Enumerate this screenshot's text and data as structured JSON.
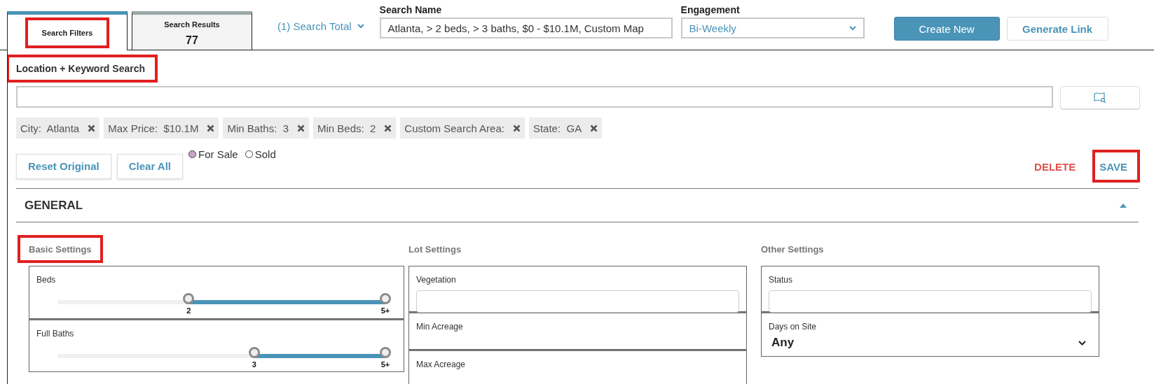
{
  "tabs": [
    {
      "label": "Search Filters",
      "selected": true,
      "highlighted": true
    },
    {
      "label": "Search Results",
      "count": "77",
      "selected": false,
      "highlighted": false
    }
  ],
  "search_total": {
    "label": "(1) Search Total"
  },
  "search_name": {
    "label": "Search Name",
    "value": "Atlanta, > 2 beds, > 3 baths, $0 - $10.1M, Custom Map"
  },
  "engagement": {
    "label": "Engagement",
    "value": "Bi-Weekly"
  },
  "header_buttons": [
    {
      "label": "Create New",
      "kind": "primary"
    },
    {
      "label": "Generate Link",
      "kind": "secondary"
    }
  ],
  "location_search": {
    "label": "Location + Keyword Search",
    "highlighted": true
  },
  "chips": [
    {
      "label": "City:  Atlanta"
    },
    {
      "label": "Max Price:  $10.1M"
    },
    {
      "label": "Min Baths:  3"
    },
    {
      "label": "Min Beds:  2"
    },
    {
      "label": "Custom Search Area:"
    },
    {
      "label": "State:  GA"
    }
  ],
  "action_buttons": [
    {
      "label": "Reset Original"
    },
    {
      "label": "Clear All"
    }
  ],
  "listing_type": [
    {
      "label": "For Sale",
      "selected": true
    },
    {
      "label": "Sold",
      "selected": false
    }
  ],
  "record_actions": [
    {
      "label": "DELETE",
      "kind": "danger",
      "highlighted": false
    },
    {
      "label": "SAVE",
      "kind": "primary",
      "highlighted": true
    }
  ],
  "section": {
    "title": "GENERAL",
    "expanded": true,
    "groups": [
      {
        "title": "Basic Settings",
        "highlighted": true,
        "fields": [
          {
            "kind": "range",
            "label": "Beds",
            "level": 0.6,
            "low": "2",
            "high": "5+"
          },
          {
            "kind": "range",
            "label": "Full Baths",
            "level": 0.4,
            "low": "3",
            "high": "5+"
          }
        ]
      },
      {
        "title": "Lot Settings",
        "highlighted": false,
        "fields": [
          {
            "kind": "text",
            "label": "Vegetation"
          },
          {
            "kind": "label",
            "label": "Min Acreage"
          },
          {
            "kind": "label",
            "label": "Max Acreage"
          }
        ]
      },
      {
        "title": "Other Settings",
        "highlighted": false,
        "fields": [
          {
            "kind": "text",
            "label": "Status"
          },
          {
            "kind": "select",
            "label": "Days on Site",
            "value": "Any"
          }
        ]
      }
    ]
  }
}
